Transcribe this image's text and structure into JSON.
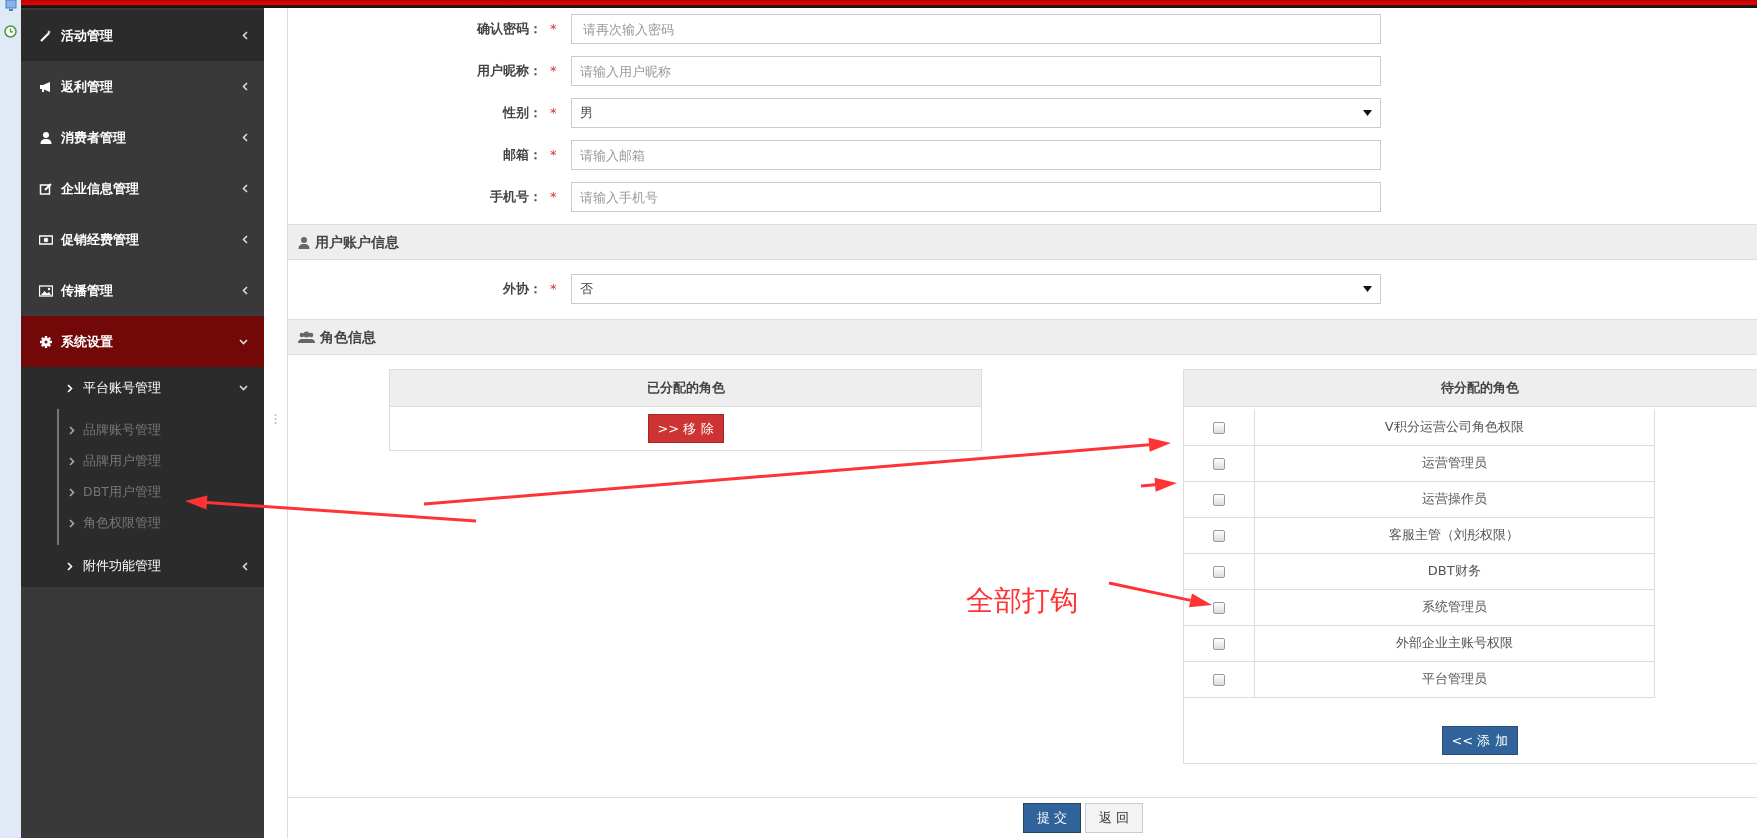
{
  "sidebar": {
    "items": [
      {
        "label": "活动管理",
        "selected": false,
        "expanded": false
      },
      {
        "label": "返利管理",
        "selected": false,
        "expanded": false
      },
      {
        "label": "消费者管理",
        "selected": false,
        "expanded": false
      },
      {
        "label": "企业信息管理",
        "selected": false,
        "expanded": false
      },
      {
        "label": "促销经费管理",
        "selected": false,
        "expanded": false
      },
      {
        "label": "传播管理",
        "selected": false,
        "expanded": false
      },
      {
        "label": "系统设置",
        "selected": true,
        "expanded": true,
        "children": [
          {
            "label": "平台账号管理",
            "expanded": true,
            "children": [
              {
                "label": "品牌账号管理"
              },
              {
                "label": "品牌用户管理"
              },
              {
                "label": "DBT用户管理"
              },
              {
                "label": "角色权限管理"
              }
            ]
          },
          {
            "label": "附件功能管理",
            "expanded": false
          }
        ]
      }
    ]
  },
  "form": {
    "fields": [
      {
        "label": "确认密码：",
        "required_mark": "*",
        "kind": "input",
        "placeholder": " 请再次输入密码"
      },
      {
        "label": "用户昵称：",
        "required_mark": "*",
        "kind": "input",
        "placeholder": "请输入用户昵称"
      },
      {
        "label": "性别：",
        "required_mark": "*",
        "kind": "select",
        "value": "男"
      },
      {
        "label": "邮箱：",
        "required_mark": "*",
        "kind": "input",
        "placeholder": "请输入邮箱"
      },
      {
        "label": "手机号：",
        "required_mark": "*",
        "kind": "input",
        "placeholder": "请输入手机号"
      }
    ]
  },
  "account_section": {
    "title": "用户账户信息",
    "fields": [
      {
        "label": "外协：",
        "required_mark": "*",
        "kind": "select",
        "value": "否"
      }
    ]
  },
  "role_section": {
    "title": "角色信息",
    "assigned": {
      "title": "已分配的角色",
      "button": ">> 移 除"
    },
    "pending": {
      "title": "待分配的角色",
      "button": "<< 添 加",
      "roles": [
        {
          "name": "V积分运营公司角色权限",
          "checked": false
        },
        {
          "name": "运营管理员",
          "checked": false
        },
        {
          "name": "运营操作员",
          "checked": false
        },
        {
          "name": "客服主管（刘彤权限）",
          "checked": false
        },
        {
          "name": "DBT财务",
          "checked": false
        },
        {
          "name": "系统管理员",
          "checked": false
        },
        {
          "name": "外部企业主账号权限",
          "checked": false
        },
        {
          "name": "平台管理员",
          "checked": false
        }
      ]
    }
  },
  "actions": [
    {
      "label": "提 交",
      "kind": "primary"
    },
    {
      "label": "返 回",
      "kind": "default"
    }
  ],
  "annotation": {
    "text": "全部打钩"
  }
}
